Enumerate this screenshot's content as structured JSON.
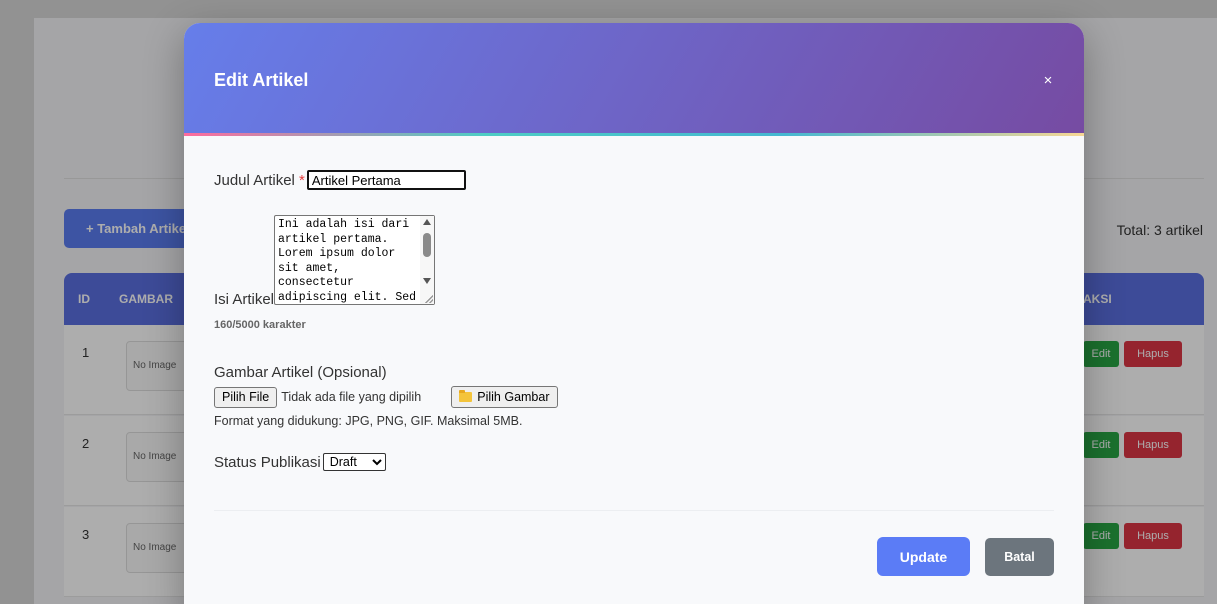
{
  "background": {
    "add_button_label": "+ Tambah Artikel",
    "total_text": "Total: 3 artikel",
    "table_headers": [
      "ID",
      "GAMBAR",
      "AKSI"
    ],
    "rows": [
      {
        "id": "1",
        "thumb_text": "No Image",
        "edit": "Edit",
        "delete": "Hapus"
      },
      {
        "id": "2",
        "thumb_text": "No Image",
        "edit": "Edit",
        "delete": "Hapus"
      },
      {
        "id": "3",
        "thumb_text": "No Image",
        "edit": "Edit",
        "delete": "Hapus"
      }
    ]
  },
  "modal": {
    "title": "Edit Artikel",
    "close_symbol": "×",
    "fields": {
      "title_label": "Judul Artikel",
      "required_mark": "*",
      "title_value": "Artikel Pertama",
      "content_label": "Isi Artikel",
      "content_value": "Ini adalah isi dari artikel pertama. Lorem ipsum dolor sit amet, consectetur adipiscing elit. Sed",
      "char_count": "160/5000 karakter",
      "image_label": "Gambar Artikel (Opsional)",
      "file_button": "Pilih File",
      "file_status": "Tidak ada file yang dipilih",
      "pick_image_button": "Pilih Gambar",
      "format_hint": "Format yang didukung: JPG, PNG, GIF. Maksimal 5MB.",
      "status_label": "Status Publikasi",
      "status_value": "Draft"
    },
    "buttons": {
      "update": "Update",
      "cancel": "Batal"
    }
  },
  "colors": {
    "header_gradient_start": "#667eea",
    "header_gradient_end": "#764ba2",
    "update_button": "#5b7cf6",
    "cancel_button": "#6c757d",
    "required": "#e53e3e"
  }
}
